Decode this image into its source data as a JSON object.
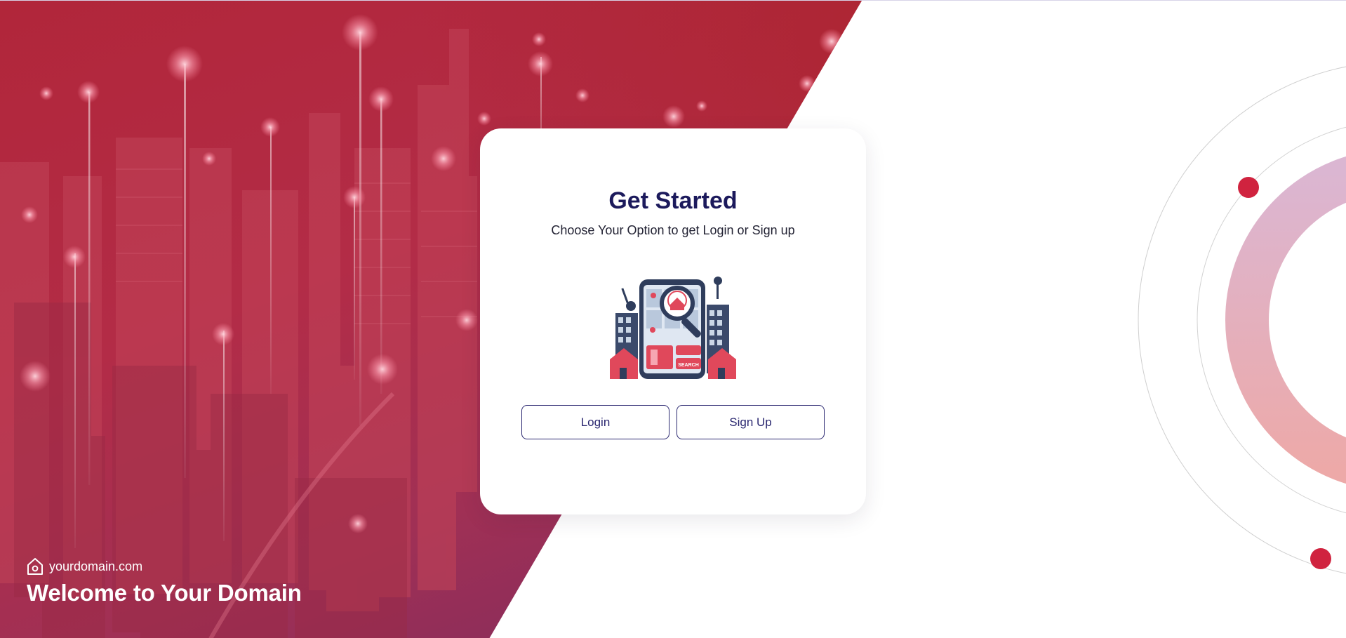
{
  "hero": {
    "domain": "yourdomain.com",
    "welcome": "Welcome to Your Domain"
  },
  "card": {
    "title": "Get Started",
    "subtitle": "Choose Your Option to get Login or Sign up",
    "illustration_badge": "SEARCH",
    "login_label": "Login",
    "signup_label": "Sign Up"
  },
  "icons": {
    "home": "home-icon",
    "illustration": "property-search-illustration"
  },
  "colors": {
    "accent": "#1c1a5c",
    "hero_red": "#b1263a",
    "hero_purple": "#6c2a5e",
    "dot_red": "#d0233f"
  }
}
